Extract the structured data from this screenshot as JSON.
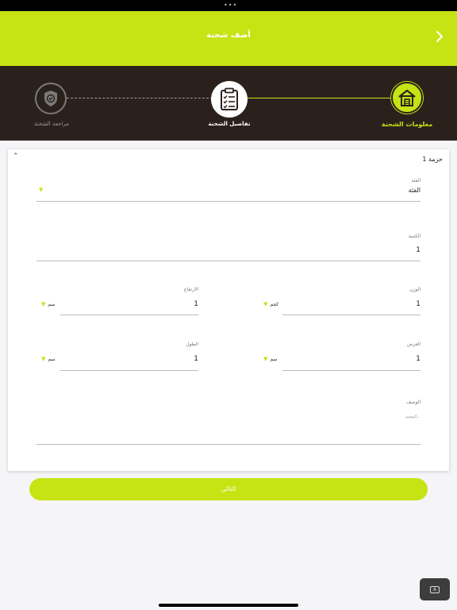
{
  "header": {
    "title": "أضف شحنة",
    "back_icon": "chevron-right-icon"
  },
  "stepper": {
    "steps": [
      {
        "label": "معلومات الشحنة",
        "icon": "house-icon",
        "state": "active"
      },
      {
        "label": "تفاصيل الشحنة",
        "icon": "clipboard-checklist-icon",
        "state": "current"
      },
      {
        "label": "مراجعة الشحنة",
        "icon": "shield-check-icon",
        "state": "upcoming"
      }
    ]
  },
  "package": {
    "title": "حزمة 1",
    "category": {
      "label": "الفئة",
      "value": "الفئة"
    },
    "quantity": {
      "label": "الكمية",
      "value": "1"
    },
    "weight": {
      "label": "الوزن",
      "value": "1",
      "unit": "كجم"
    },
    "height": {
      "label": "الارتفاع",
      "value": "1",
      "unit": "سم"
    },
    "width": {
      "label": "العرض",
      "value": "1",
      "unit": "سم"
    },
    "length": {
      "label": "الطول",
      "value": "1",
      "unit": "سم"
    },
    "description": {
      "label": "الوصف",
      "placeholder": "الوصف..."
    }
  },
  "next_button": "التالي",
  "keyboard_button": {
    "icon": "keyboard-icon",
    "label": "A"
  },
  "colors": {
    "accent": "#c6e314",
    "stepper_bg": "#2b211c"
  }
}
